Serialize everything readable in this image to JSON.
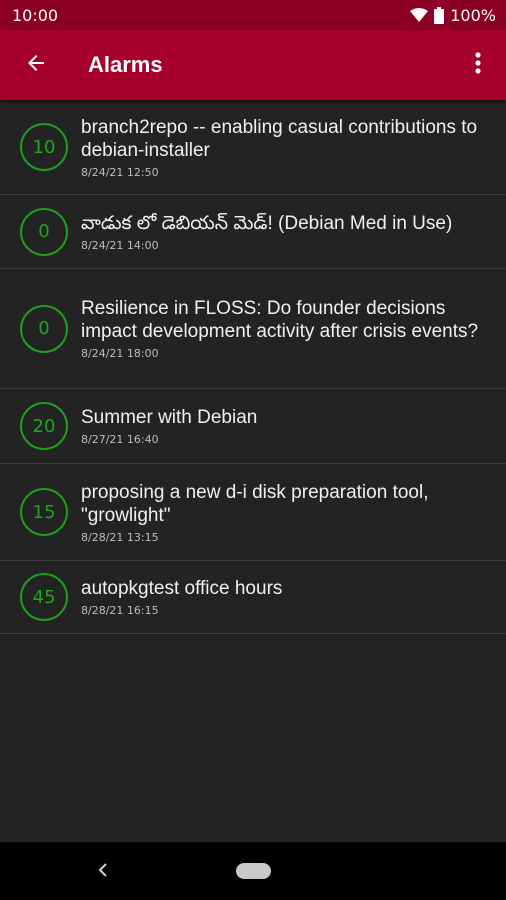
{
  "status_bar": {
    "time": "10:00",
    "battery": "100%"
  },
  "app_bar": {
    "title": "Alarms"
  },
  "alarms": [
    {
      "count": "10",
      "title": "branch2repo -- enabling casual contributions to debian-installer",
      "time": "8/24/21 12:50"
    },
    {
      "count": "0",
      "title": "వాడుక లో డెబియన్ మెడ్! (Debian Med in Use)",
      "time": "8/24/21 14:00"
    },
    {
      "count": "0",
      "title": "Resilience in FLOSS: Do founder decisions impact development activity after crisis events?",
      "time": "8/24/21 18:00"
    },
    {
      "count": "20",
      "title": "Summer with Debian",
      "time": "8/27/21 16:40"
    },
    {
      "count": "15",
      "title": "proposing a new d-i disk preparation tool, \"growlight\"",
      "time": "8/28/21 13:15"
    },
    {
      "count": "45",
      "title": "autopkgtest office hours",
      "time": "8/28/21 16:15"
    }
  ],
  "colors": {
    "app_bar": "#a6002c",
    "status_bar": "#8b0024",
    "badge": "#1fa51f",
    "background": "#232323"
  },
  "icons": {
    "back": "arrow-left-icon",
    "menu": "more-vert-icon",
    "wifi": "wifi-icon",
    "battery": "battery-icon"
  }
}
